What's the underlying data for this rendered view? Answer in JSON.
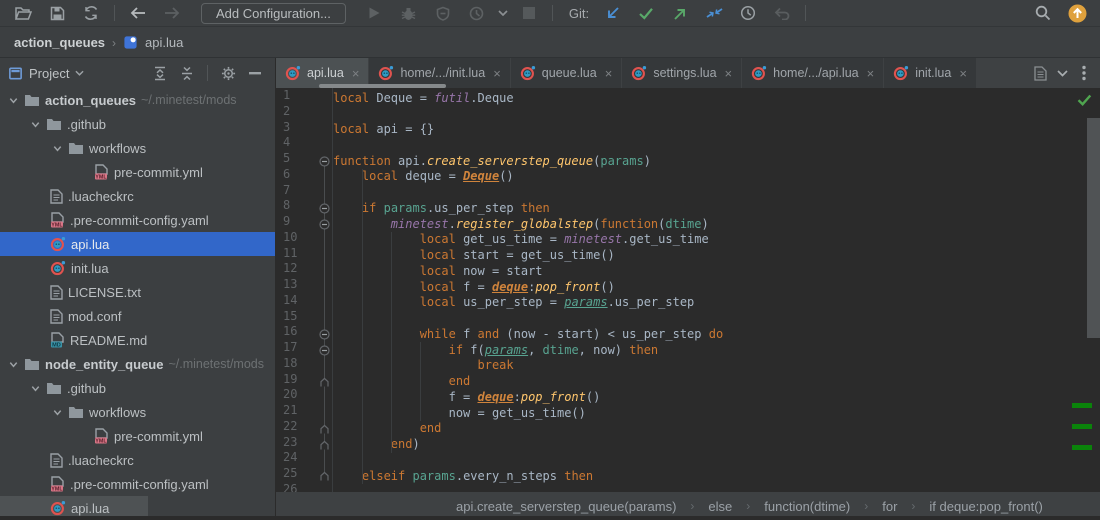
{
  "toolbar": {
    "add_configuration": "Add Configuration...",
    "git_label": "Git:"
  },
  "navbar": {
    "project": "action_queues",
    "separator": "›",
    "file": "api.lua"
  },
  "project_panel": {
    "title": "Project",
    "tree": [
      {
        "label": "action_queues",
        "path": "~/.minetest/mods",
        "type": "folder",
        "indent": 0,
        "chevron": true,
        "bold": true
      },
      {
        "label": ".github",
        "type": "folder",
        "indent": 1,
        "chevron": true
      },
      {
        "label": "workflows",
        "type": "folder",
        "indent": 2,
        "chevron": true
      },
      {
        "label": "pre-commit.yml",
        "type": "yml",
        "indent": 3
      },
      {
        "label": ".luacheckrc",
        "type": "text",
        "indent": 1
      },
      {
        "label": ".pre-commit-config.yaml",
        "type": "yml",
        "indent": 1
      },
      {
        "label": "api.lua",
        "type": "lua",
        "indent": 1,
        "selected": true
      },
      {
        "label": "init.lua",
        "type": "lua",
        "indent": 1
      },
      {
        "label": "LICENSE.txt",
        "type": "text",
        "indent": 1
      },
      {
        "label": "mod.conf",
        "type": "text",
        "indent": 1
      },
      {
        "label": "README.md",
        "type": "md",
        "indent": 1
      },
      {
        "label": "node_entity_queue",
        "path": "~/.minetest/mods",
        "type": "folder",
        "indent": 0,
        "chevron": true,
        "bold": true
      },
      {
        "label": ".github",
        "type": "folder",
        "indent": 1,
        "chevron": true
      },
      {
        "label": "workflows",
        "type": "folder",
        "indent": 2,
        "chevron": true
      },
      {
        "label": "pre-commit.yml",
        "type": "yml",
        "indent": 3
      },
      {
        "label": ".luacheckrc",
        "type": "text",
        "indent": 1
      },
      {
        "label": ".pre-commit-config.yaml",
        "type": "yml",
        "indent": 1
      },
      {
        "label": "api.lua",
        "type": "lua",
        "indent": 1,
        "hover": true
      }
    ]
  },
  "tabs": [
    {
      "label": "api.lua",
      "active": true
    },
    {
      "label": "home/.../init.lua",
      "active": false
    },
    {
      "label": "queue.lua",
      "active": false
    },
    {
      "label": "settings.lua",
      "active": false
    },
    {
      "label": "home/.../api.lua",
      "active": false
    },
    {
      "label": "init.lua",
      "active": false
    }
  ],
  "editor": {
    "folds": {
      "minus": [
        5,
        8,
        9,
        16,
        17
      ],
      "end": [
        19,
        22,
        23,
        25
      ]
    },
    "lines": [
      {
        "n": 1,
        "toks": [
          [
            "local ",
            "k"
          ],
          [
            "Deque = ",
            "p"
          ],
          [
            "futil",
            "g"
          ],
          [
            ".Deque",
            "p"
          ]
        ]
      },
      {
        "n": 2,
        "toks": []
      },
      {
        "n": 3,
        "toks": [
          [
            "local ",
            "k"
          ],
          [
            "api = {}",
            "p"
          ]
        ]
      },
      {
        "n": 4,
        "toks": []
      },
      {
        "n": 5,
        "toks": [
          [
            "function ",
            "k"
          ],
          [
            "api.",
            "p"
          ],
          [
            "create_serverstep_queue",
            "fn"
          ],
          [
            "(",
            "p"
          ],
          [
            "params",
            "pa"
          ],
          [
            ")",
            "p"
          ]
        ]
      },
      {
        "n": 6,
        "toks": [
          [
            "    ",
            "p"
          ],
          [
            "local ",
            "k"
          ],
          [
            "deque = ",
            "p"
          ],
          [
            "Deque",
            "up"
          ],
          [
            "()",
            "p"
          ]
        ]
      },
      {
        "n": 7,
        "toks": []
      },
      {
        "n": 8,
        "toks": [
          [
            "    ",
            "p"
          ],
          [
            "if ",
            "k"
          ],
          [
            "params",
            "pa"
          ],
          [
            ".us_per_step ",
            "p"
          ],
          [
            "then",
            "k"
          ]
        ]
      },
      {
        "n": 9,
        "toks": [
          [
            "        ",
            "p"
          ],
          [
            "minetest",
            "g"
          ],
          [
            ".",
            "p"
          ],
          [
            "register_globalstep",
            "fn"
          ],
          [
            "(",
            "p"
          ],
          [
            "function",
            "k"
          ],
          [
            "(",
            "p"
          ],
          [
            "dtime",
            "pa"
          ],
          [
            ")",
            "p"
          ]
        ]
      },
      {
        "n": 10,
        "toks": [
          [
            "            ",
            "p"
          ],
          [
            "local ",
            "k"
          ],
          [
            "get_us_time = ",
            "p"
          ],
          [
            "minetest",
            "g"
          ],
          [
            ".get_us_time",
            "p"
          ]
        ]
      },
      {
        "n": 11,
        "toks": [
          [
            "            ",
            "p"
          ],
          [
            "local ",
            "k"
          ],
          [
            "start = get_us_time()",
            "p"
          ]
        ]
      },
      {
        "n": 12,
        "toks": [
          [
            "            ",
            "p"
          ],
          [
            "local ",
            "k"
          ],
          [
            "now = start",
            "p"
          ]
        ]
      },
      {
        "n": 13,
        "toks": [
          [
            "            ",
            "p"
          ],
          [
            "local ",
            "k"
          ],
          [
            "f = ",
            "p"
          ],
          [
            "deque",
            "up"
          ],
          [
            ":",
            "p"
          ],
          [
            "pop_front",
            "fn"
          ],
          [
            "()",
            "p"
          ]
        ]
      },
      {
        "n": 14,
        "toks": [
          [
            "            ",
            "p"
          ],
          [
            "local ",
            "k"
          ],
          [
            "us_per_step = ",
            "p"
          ],
          [
            "params",
            "pau"
          ],
          [
            ".us_per_step",
            "p"
          ]
        ]
      },
      {
        "n": 15,
        "toks": []
      },
      {
        "n": 16,
        "toks": [
          [
            "            ",
            "p"
          ],
          [
            "while ",
            "k"
          ],
          [
            "f ",
            "p"
          ],
          [
            "and ",
            "k"
          ],
          [
            "(now - start) < us_per_step ",
            "p"
          ],
          [
            "do",
            "k"
          ]
        ]
      },
      {
        "n": 17,
        "toks": [
          [
            "                ",
            "p"
          ],
          [
            "if ",
            "k"
          ],
          [
            "f(",
            "p"
          ],
          [
            "params",
            "pau"
          ],
          [
            ", ",
            "p"
          ],
          [
            "dtime",
            "pa"
          ],
          [
            ", now) ",
            "p"
          ],
          [
            "then",
            "k"
          ]
        ]
      },
      {
        "n": 18,
        "toks": [
          [
            "                    ",
            "p"
          ],
          [
            "break",
            "k"
          ]
        ]
      },
      {
        "n": 19,
        "toks": [
          [
            "                ",
            "p"
          ],
          [
            "end",
            "k"
          ]
        ]
      },
      {
        "n": 20,
        "toks": [
          [
            "                ",
            "p"
          ],
          [
            "f = ",
            "p"
          ],
          [
            "deque",
            "up"
          ],
          [
            ":",
            "p"
          ],
          [
            "pop_front",
            "fn"
          ],
          [
            "()",
            "p"
          ]
        ]
      },
      {
        "n": 21,
        "toks": [
          [
            "                ",
            "p"
          ],
          [
            "now = get_us_time()",
            "p"
          ]
        ]
      },
      {
        "n": 22,
        "toks": [
          [
            "            ",
            "p"
          ],
          [
            "end",
            "k"
          ]
        ]
      },
      {
        "n": 23,
        "toks": [
          [
            "        ",
            "p"
          ],
          [
            "end",
            "k"
          ],
          [
            ")",
            "p"
          ]
        ]
      },
      {
        "n": 24,
        "toks": []
      },
      {
        "n": 25,
        "toks": [
          [
            "    ",
            "p"
          ],
          [
            "elseif ",
            "k"
          ],
          [
            "params",
            "pa"
          ],
          [
            ".every_n_steps ",
            "p"
          ],
          [
            "then",
            "k"
          ]
        ]
      },
      {
        "n": 26,
        "toks": []
      }
    ]
  },
  "crumbs": [
    "api.create_serverstep_queue(params)",
    "else",
    "function(dtime)",
    "for",
    "if deque:pop_front()"
  ],
  "colors": {
    "selection_blue": "#3267c9",
    "editor_bg": "#2b2b2b",
    "chrome_bg": "#3c3f41",
    "keyword": "#cc7832",
    "plain": "#a9b7c6",
    "function_name": "#ffc66d",
    "global": "#9876aa",
    "parameter": "#58a390",
    "vcs_green": "#0a830a",
    "git_blue": "#4a8fd4",
    "git_green": "#59a869",
    "update_orange": "#dfa13d"
  }
}
